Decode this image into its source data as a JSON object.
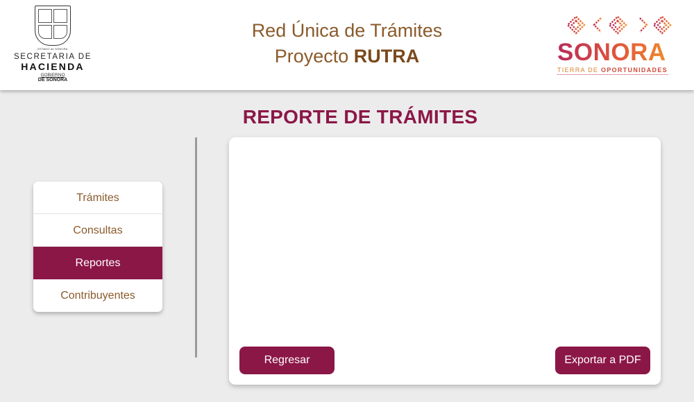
{
  "header": {
    "left_logo": {
      "crest_banner": "ESTADO de SONORA",
      "line1": "SECRETARIA DE",
      "line2": "HACIENDA",
      "line3": "GOBIERNO",
      "line4": "DE SONORA"
    },
    "title_line1": "Red Única de Trámites",
    "title_line2_prefix": "Proyecto ",
    "title_line2_bold": "RUTRA",
    "right_logo": {
      "word": "SONORA",
      "tag_prefix": "TIERRA DE ",
      "tag_bold": "OPORTUNIDADES"
    }
  },
  "page_title": "REPORTE DE TRÁMITES",
  "menu": {
    "items": [
      {
        "label": "Trámites",
        "active": false
      },
      {
        "label": "Consultas",
        "active": false
      },
      {
        "label": "Reportes",
        "active": true
      },
      {
        "label": "Contribuyentes",
        "active": false
      }
    ]
  },
  "panel": {
    "back_label": "Regresar",
    "export_label": "Exportar a PDF"
  },
  "colors": {
    "primary": "#8b1747",
    "accent_text": "#8a5a2b",
    "background": "#ececec"
  }
}
